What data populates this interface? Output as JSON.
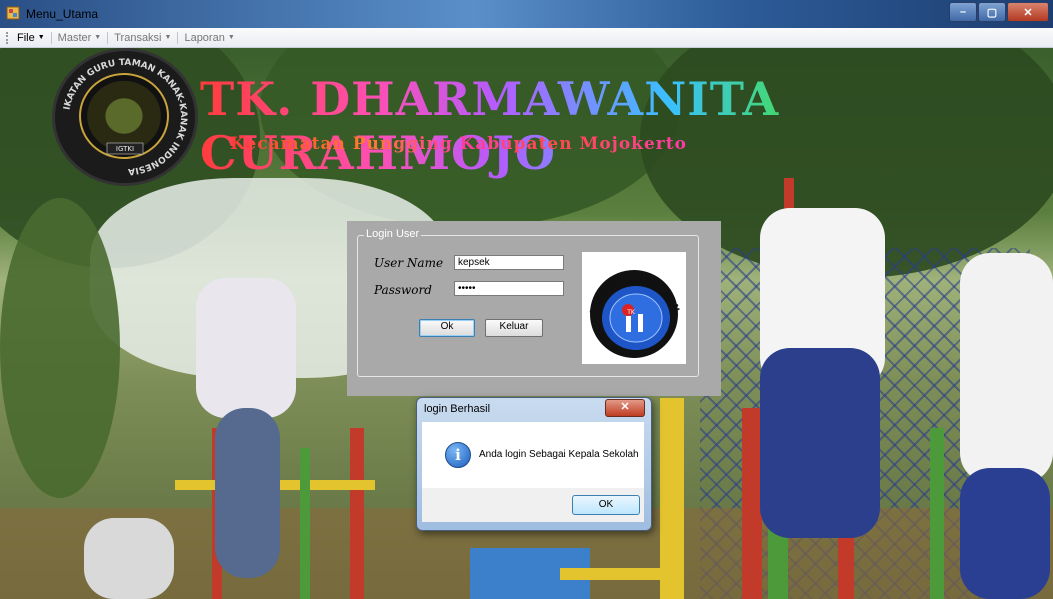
{
  "window": {
    "title": "Menu_Utama",
    "controls": {
      "minimize": "–",
      "maximize": "▢",
      "close": "✕"
    }
  },
  "menubar": {
    "items": [
      {
        "label": "File"
      },
      {
        "label": "Master"
      },
      {
        "label": "Transaksi"
      },
      {
        "label": "Laporan"
      }
    ]
  },
  "header": {
    "school_name": "TK. DHARMAWANITA CURAHMOJO",
    "subtitle": "Kecamatan Pungging Kabupaten Mojokerto",
    "logo_text": "IKATAN GURU TAMAN KANAK-KANAK INDONESIA",
    "logo_badge": "IGTKI"
  },
  "login": {
    "group_title": "Login User",
    "username_label": "User Name",
    "username_value": "kepsek",
    "password_label": "Password",
    "password_value": "•••••",
    "ok_label": "Ok",
    "exit_label": "Keluar",
    "logo_text": "TAMAN KANAK - KANAK",
    "logo_badge": "TK"
  },
  "message_box": {
    "title": "login Berhasil",
    "close": "✕",
    "message": "Anda login Sebagai Kepala Sekolah",
    "ok_label": "OK",
    "icon": "info-icon"
  }
}
